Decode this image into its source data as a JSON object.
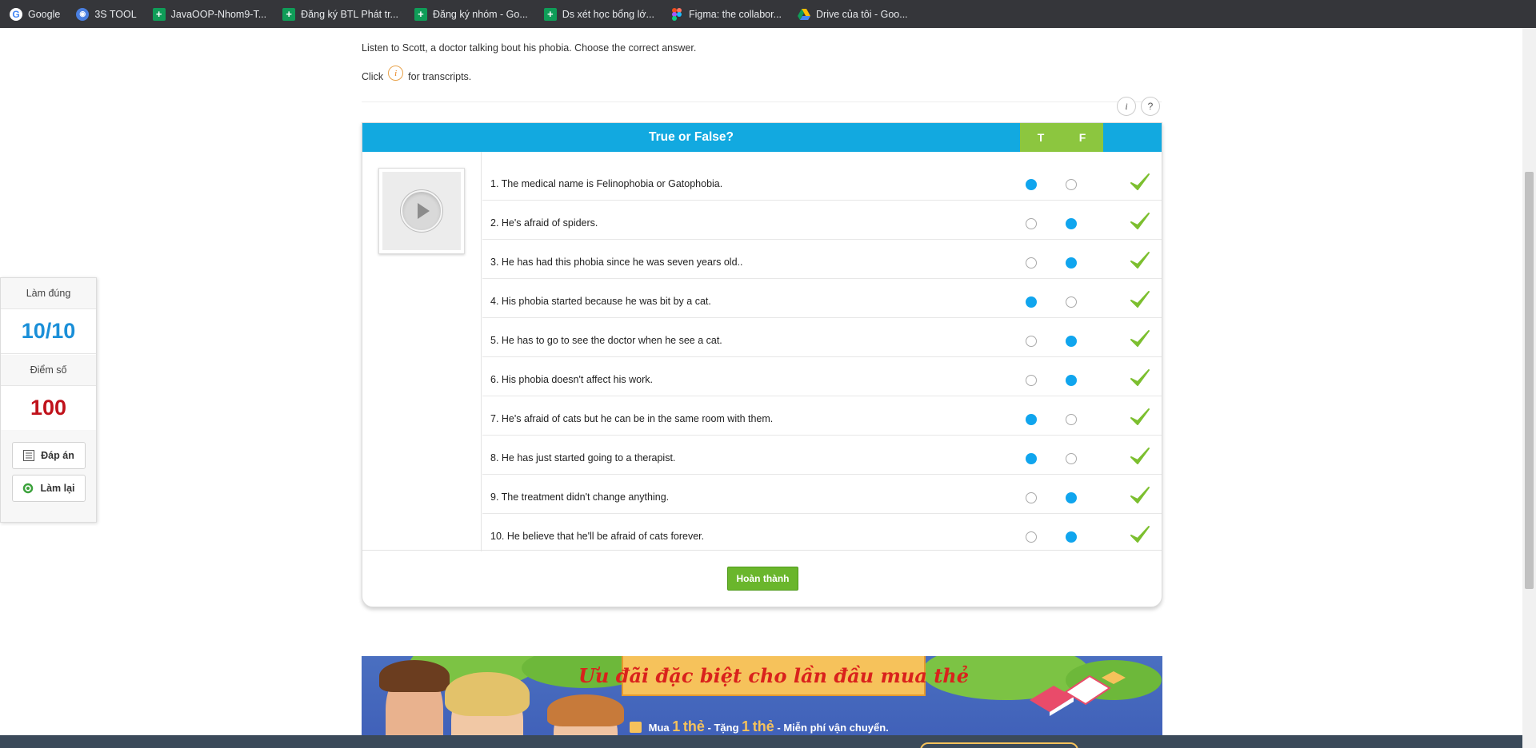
{
  "bookmarks": [
    {
      "label": "Google",
      "icon": "google-icon"
    },
    {
      "label": "3S TOOL",
      "icon": "globe-icon"
    },
    {
      "label": "JavaOOP-Nhom9-T...",
      "icon": "sheets-icon"
    },
    {
      "label": "Đăng ký BTL Phát tr...",
      "icon": "sheets-icon"
    },
    {
      "label": "Đăng ký nhóm - Go...",
      "icon": "sheets-icon"
    },
    {
      "label": "Ds xét học bổng lớ...",
      "icon": "sheets-icon"
    },
    {
      "label": "Figma: the collabor...",
      "icon": "figma-icon"
    },
    {
      "label": "Drive của tôi - Goo...",
      "icon": "drive-icon"
    }
  ],
  "instructions": {
    "line1": "Listen to Scott, a doctor talking bout his phobia. Choose the correct answer.",
    "click_prefix": "Click",
    "click_icon": "i",
    "click_suffix": "for transcripts."
  },
  "top_buttons": {
    "info": "i",
    "help": "?"
  },
  "quiz": {
    "title": "True or False?",
    "col_t": "T",
    "col_f": "F",
    "questions": [
      {
        "text": "1. The medical name is Felinophobia or Gatophobia.",
        "answer": "T",
        "correct": true
      },
      {
        "text": "2. He's afraid of spiders.",
        "answer": "F",
        "correct": true
      },
      {
        "text": "3. He has had this phobia since he was seven years old..",
        "answer": "F",
        "correct": true
      },
      {
        "text": "4. His phobia started because he was bit by a cat.",
        "answer": "T",
        "correct": true
      },
      {
        "text": "5. He has to go to see the doctor when he see a cat.",
        "answer": "F",
        "correct": true
      },
      {
        "text": "6. His phobia doesn't affect his work.",
        "answer": "F",
        "correct": true
      },
      {
        "text": "7. He's afraid of cats but he can be in the same room with them.",
        "answer": "T",
        "correct": true
      },
      {
        "text": "8. He has just started going to a therapist.",
        "answer": "T",
        "correct": true
      },
      {
        "text": "9. The treatment didn't change anything.",
        "answer": "F",
        "correct": true
      },
      {
        "text": "10. He believe that he'll be afraid of cats forever.",
        "answer": "F",
        "correct": true
      }
    ],
    "finish_label": "Hoàn thành"
  },
  "score_panel": {
    "correct_label": "Làm đúng",
    "correct_value": "10/10",
    "score_label": "Điểm số",
    "score_value": "100",
    "answers_button": "Đáp án",
    "retry_button": "Làm lại"
  },
  "banner": {
    "title": "Ưu đãi đặc biệt cho lần đầu mua thẻ",
    "sub_mua": "Mua",
    "sub_1a": "1",
    "sub_the_a": "thẻ",
    "sub_tang": "- Tặng",
    "sub_1b": "1",
    "sub_the_b": "thẻ",
    "sub_free": "- Miễn phí vận chuyển."
  },
  "colors": {
    "header_blue": "#12a9e0",
    "tf_green": "#8cc63f",
    "radio_selected": "#10a5ee",
    "finish_green": "#6ab62c",
    "score_blue": "#1a8fd8",
    "score_red": "#c0121b",
    "check_green": "#7cbf2f"
  }
}
